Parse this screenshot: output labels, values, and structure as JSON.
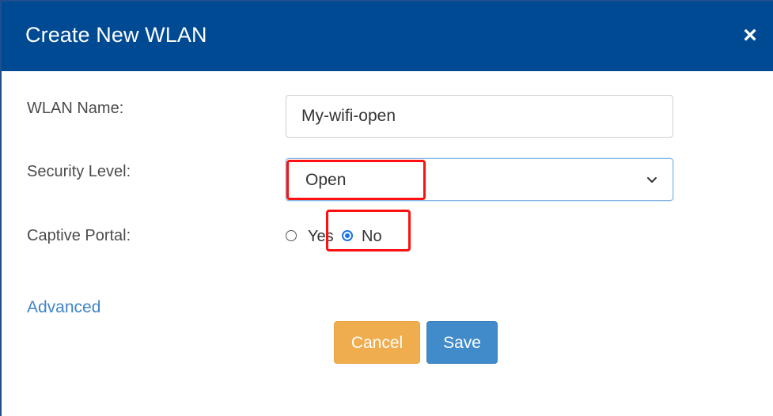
{
  "dialog": {
    "title": "Create New WLAN",
    "close_label": "×"
  },
  "form": {
    "wlan_name": {
      "label": "WLAN Name:",
      "value": "My-wifi-open"
    },
    "security_level": {
      "label": "Security Level:",
      "selected": "Open",
      "icon": "chevron-down-icon"
    },
    "captive_portal": {
      "label": "Captive Portal:",
      "options": [
        {
          "label": "Yes",
          "selected": false
        },
        {
          "label": "No",
          "selected": true
        }
      ]
    }
  },
  "links": {
    "advanced": "Advanced"
  },
  "buttons": {
    "cancel": "Cancel",
    "save": "Save"
  },
  "colors": {
    "header": "#004a93",
    "cancel": "#f0ad4e",
    "save": "#428bca",
    "highlight": "#ff1010",
    "link": "#3f84c7"
  }
}
